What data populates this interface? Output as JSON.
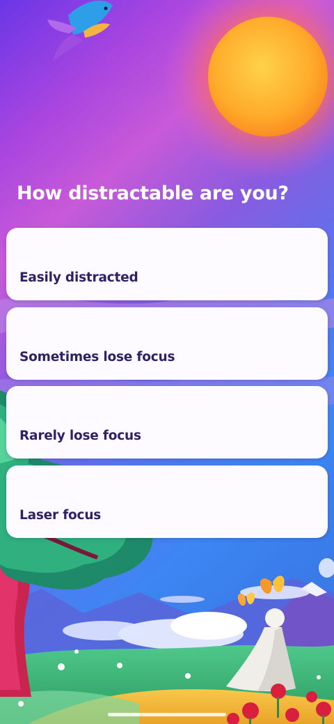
{
  "question": {
    "title": "How distractable are you?"
  },
  "options": [
    {
      "label": "Easily distracted"
    },
    {
      "label": "Sometimes lose focus"
    },
    {
      "label": "Rarely lose focus"
    },
    {
      "label": "Laser focus"
    }
  ],
  "icons": {
    "bird": "bird-icon",
    "sun": "sun-icon",
    "butterflies": "butterfly-icon",
    "character": "character-figure"
  },
  "colors": {
    "sky_top": "#7a3de8",
    "sky_mid": "#c34fd9",
    "sun_core": "#ffb02e",
    "card_bg": "#fdfbff",
    "card_text": "#2c2366"
  }
}
